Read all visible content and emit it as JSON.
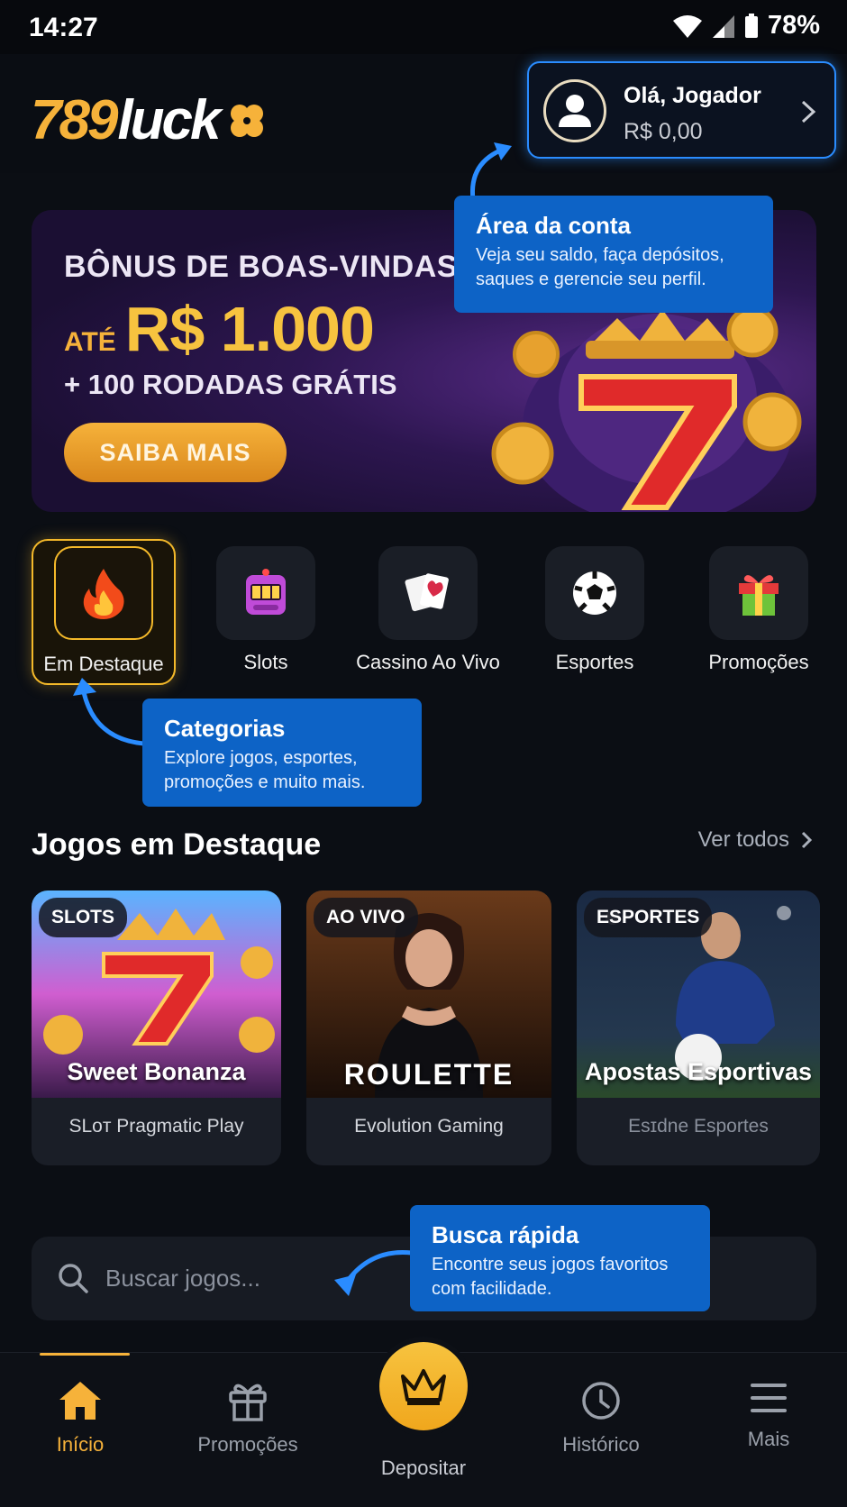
{
  "status_bar": {
    "time": "14:27",
    "battery": "78%"
  },
  "header": {
    "logo_number": "789",
    "logo_word": "luck",
    "account": {
      "greeting": "Olá, Jogador",
      "balance": "R$ 0,00"
    }
  },
  "banner": {
    "title": "BÔNUS DE BOAS-VINDAS",
    "amount_prefix": "ATÉ",
    "amount": "R$ 1.000",
    "subtitle": "+ 100 RODADAS GRÁTIS",
    "cta": "SAIBA MAIS"
  },
  "tooltips": {
    "account": {
      "title": "Área da conta",
      "text": "Veja seu saldo, faça depósitos, saques e gerencie seu perfil."
    },
    "categories": {
      "title": "Categorias",
      "text": "Explore jogos, esportes, promoções e muito mais."
    },
    "search": {
      "title": "Busca rápida",
      "text": "Encontre seus jogos favoritos com facilidade."
    }
  },
  "categories": [
    {
      "label": "Em Destaque",
      "icon": "fire-icon",
      "active": true
    },
    {
      "label": "Slots",
      "icon": "slot-machine-icon"
    },
    {
      "label": "Cassino Ao Vivo",
      "icon": "playing-cards-icon"
    },
    {
      "label": "Esportes",
      "icon": "soccer-ball-icon"
    },
    {
      "label": "Promoções",
      "icon": "gift-icon"
    }
  ],
  "featured": {
    "title": "Jogos em Destaque",
    "see_all": "Ver todos",
    "games": [
      {
        "tag": "SLOTS",
        "name": "Sweet Bonanza",
        "provider": "SLoᴛ Pragmatic Play"
      },
      {
        "tag": "AO VIVO",
        "name": "ROULETTE",
        "provider": "Evolution Gaming"
      },
      {
        "tag": "ESPORTES",
        "name": "Apostas Esportivas",
        "provider": "Esɪdne Esportes"
      }
    ]
  },
  "search": {
    "placeholder": "Buscar jogos..."
  },
  "bottom_nav": {
    "items": [
      {
        "label": "Início",
        "icon": "home-icon",
        "active": true
      },
      {
        "label": "Promoções",
        "icon": "gift-icon"
      },
      {
        "label": "Depositar",
        "icon": "crown-icon"
      },
      {
        "label": "Histórico",
        "icon": "clock-icon"
      },
      {
        "label": "Mais",
        "icon": "menu-icon"
      }
    ]
  },
  "colors": {
    "accent": "#f6b23a",
    "tooltip": "#0d63c6",
    "background": "#0b0e14"
  }
}
